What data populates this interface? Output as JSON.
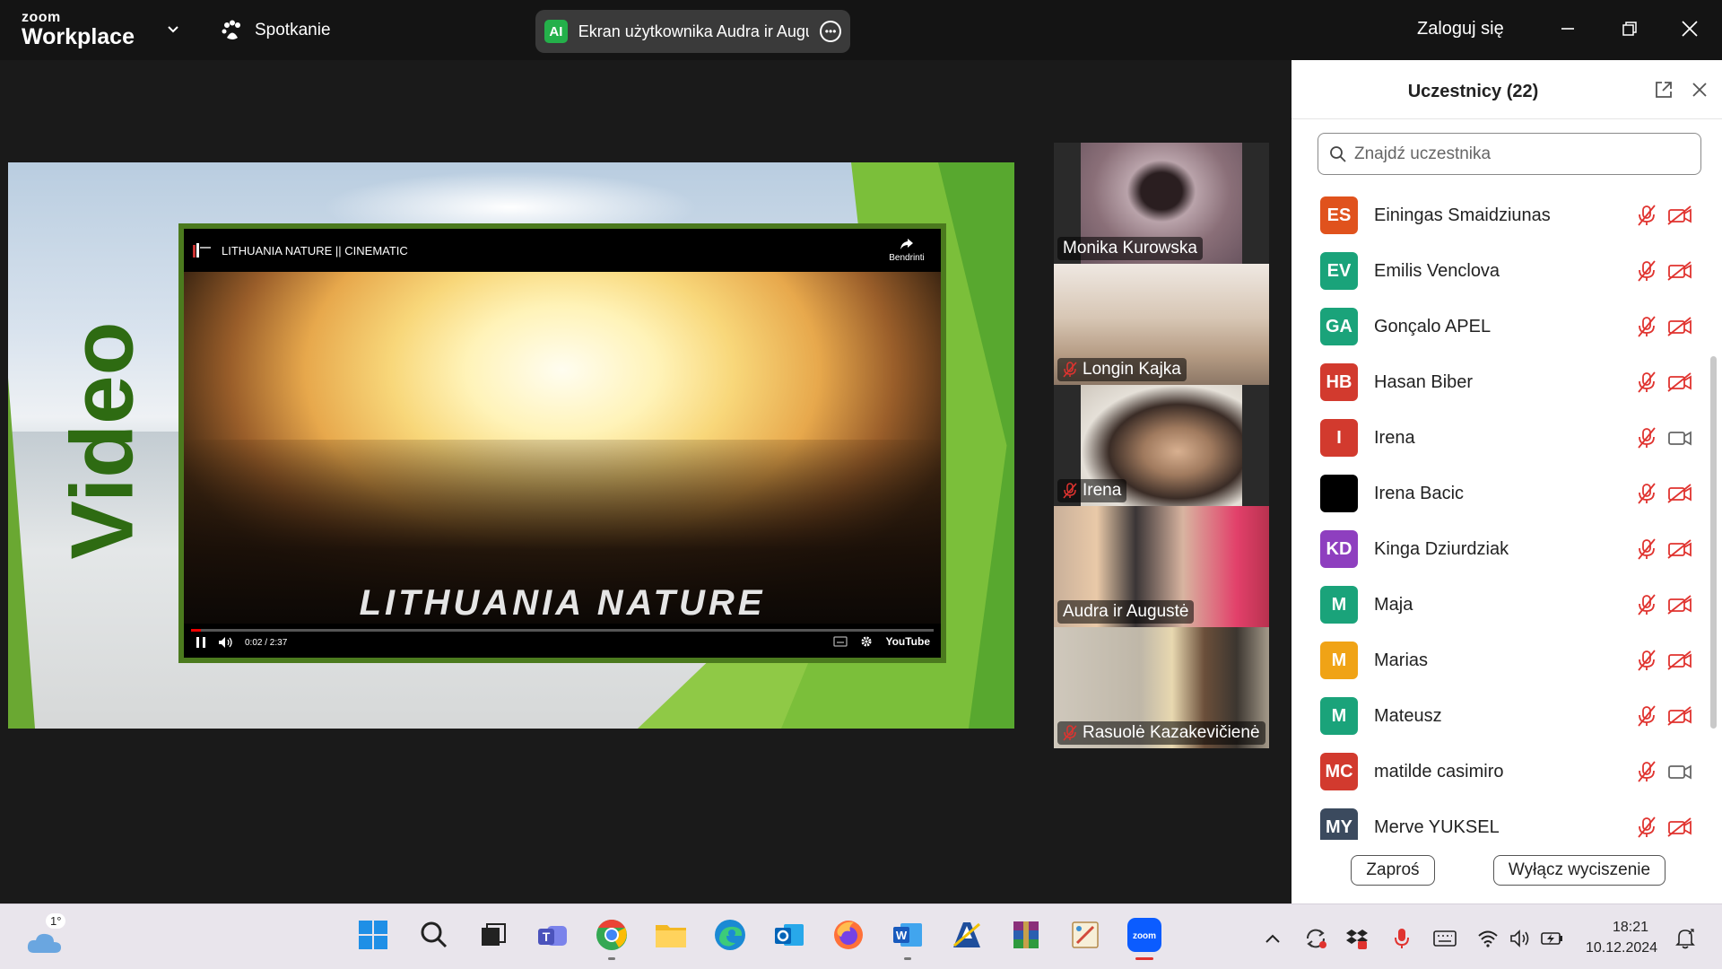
{
  "titlebar": {
    "brand_small": "zoom",
    "brand_big": "Workplace",
    "meeting_label": "Spotkanie",
    "share_badge": "AI",
    "share_text": "Ekran użytkownika Audra ir Augustė",
    "login": "Zaloguj się"
  },
  "slide": {
    "title": "Video",
    "player": {
      "title": "LITHUANIA NATURE || CINEMATIC",
      "share_label": "Bendrinti",
      "overlay_text": "LITHUANIA NATURE",
      "time": "0:02 / 2:37",
      "progress": 0.013,
      "brand": "YouTube"
    }
  },
  "gallery": [
    {
      "name": "Monika Kurowska",
      "muted": false,
      "active": false,
      "tone": "#9a7f88"
    },
    {
      "name": "Longin Kajka",
      "muted": true,
      "active": false,
      "tone": "#b49a82"
    },
    {
      "name": "Irena",
      "muted": true,
      "active": false,
      "tone": "#8a7060"
    },
    {
      "name": "Audra ir Augustė",
      "muted": false,
      "active": true,
      "tone": "#c9a07a"
    },
    {
      "name": "Rasuolė Kazakevičienė",
      "muted": true,
      "active": false,
      "tone": "#a89a86"
    }
  ],
  "panel": {
    "title": "Uczestnicy (22)",
    "search_placeholder": "Znajdź uczestnika",
    "participants": [
      {
        "initials": "ES",
        "name": "Einingas Smaidziunas",
        "color": "#e0521d",
        "video_on": false
      },
      {
        "initials": "EV",
        "name": "Emilis Venclova",
        "color": "#1aa37a",
        "video_on": false
      },
      {
        "initials": "GA",
        "name": "Gonçalo APEL",
        "color": "#1aa37a",
        "video_on": false
      },
      {
        "initials": "HB",
        "name": "Hasan Biber",
        "color": "#d23a2e",
        "video_on": false
      },
      {
        "initials": "I",
        "name": "Irena",
        "color": "#d23a2e",
        "video_on": true
      },
      {
        "initials": "",
        "name": "Irena Bacic",
        "color": "#000000",
        "video_on": false
      },
      {
        "initials": "KD",
        "name": "Kinga Dziurdziak",
        "color": "#8e3fbf",
        "video_on": false
      },
      {
        "initials": "M",
        "name": "Maja",
        "color": "#1aa37a",
        "video_on": false
      },
      {
        "initials": "M",
        "name": "Marias",
        "color": "#f0a316",
        "video_on": false
      },
      {
        "initials": "M",
        "name": "Mateusz",
        "color": "#1aa37a",
        "video_on": false
      },
      {
        "initials": "MC",
        "name": "matilde casimiro",
        "color": "#d23a2e",
        "video_on": true
      },
      {
        "initials": "MY",
        "name": "Merve YUKSEL",
        "color": "#3b4a5e",
        "video_on": false
      }
    ],
    "invite_label": "Zaproś",
    "mute_all_label": "Wyłącz wyciszenie"
  },
  "taskbar": {
    "weather_temp": "1°",
    "apps": [
      "windows-start-icon",
      "search-icon",
      "task-view-icon",
      "teams-icon",
      "chrome-icon",
      "file-explorer-icon",
      "edge-icon",
      "outlook-icon",
      "firefox-icon",
      "word-icon",
      "app-a-icon",
      "winrar-icon",
      "paint-icon",
      "zoom-icon"
    ],
    "time": "18:21",
    "date": "10.12.2024"
  },
  "colors": {
    "accent_green": "#2fd08b",
    "mute_red": "#e0332f",
    "slide_green": "#2e6b12"
  }
}
